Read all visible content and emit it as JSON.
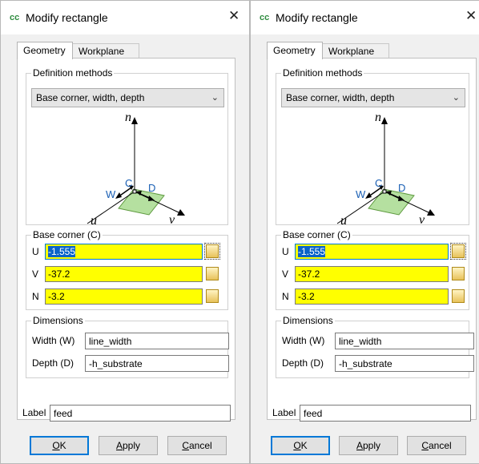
{
  "dialogs": [
    {
      "title": "Modify rectangle",
      "close_glyph": "✕",
      "tabs": [
        "Geometry",
        "Workplane"
      ],
      "active_tab": "Geometry",
      "definition_methods": {
        "legend": "Definition methods",
        "selected": "Base corner, width, depth"
      },
      "diagram": {
        "n": "n",
        "u": "u",
        "v": "v",
        "C": "C",
        "W": "W",
        "D": "D"
      },
      "base_corner": {
        "legend": "Base corner (C)",
        "fields": [
          {
            "label": "U",
            "value": "-1.555"
          },
          {
            "label": "V",
            "value": "-37.2"
          },
          {
            "label": "N",
            "value": "-3.2"
          }
        ]
      },
      "dimensions": {
        "legend": "Dimensions",
        "width": {
          "label": "Width (W)",
          "value": "line_width"
        },
        "depth": {
          "label": "Depth (D)",
          "value": "-h_substrate"
        }
      },
      "label": {
        "label": "Label",
        "value": "feed"
      },
      "buttons": {
        "ok": {
          "mnemonic": "O",
          "rest": "K"
        },
        "apply": {
          "mnemonic": "A",
          "rest": "pply"
        },
        "cancel": {
          "mnemonic": "C",
          "rest": "ancel"
        }
      }
    },
    {
      "title": "Modify rectangle",
      "close_glyph": "✕",
      "tabs": [
        "Geometry",
        "Workplane"
      ],
      "active_tab": "Geometry",
      "definition_methods": {
        "legend": "Definition methods",
        "selected": "Base corner, width, depth"
      },
      "diagram": {
        "n": "n",
        "u": "u",
        "v": "v",
        "C": "C",
        "W": "W",
        "D": "D"
      },
      "base_corner": {
        "legend": "Base corner (C)",
        "fields": [
          {
            "label": "U",
            "value": "-1.555"
          },
          {
            "label": "V",
            "value": "-37.2"
          },
          {
            "label": "N",
            "value": "-3.2"
          }
        ]
      },
      "dimensions": {
        "legend": "Dimensions",
        "width": {
          "label": "Width (W)",
          "value": "line_width"
        },
        "depth": {
          "label": "Depth (D)",
          "value": "-h_substrate"
        }
      },
      "label": {
        "label": "Label",
        "value": "feed"
      },
      "buttons": {
        "ok": {
          "mnemonic": "O",
          "rest": "K"
        },
        "apply": {
          "mnemonic": "A",
          "rest": "pply"
        },
        "cancel": {
          "mnemonic": "C",
          "rest": "ancel"
        }
      }
    }
  ],
  "colors": {
    "field_highlight": "#ffff00",
    "selection": "#0a64c8",
    "default_button_border": "#0078d7",
    "rectangle_fill": "#b5e0a0",
    "rectangle_stroke": "#5e9a3f",
    "diagram_label_blue": "#1a5fb4"
  },
  "icons": {
    "app": "cst-app-icon",
    "lock": "lock-icon",
    "close": "close-icon",
    "chevron": "chevron-down-icon"
  }
}
